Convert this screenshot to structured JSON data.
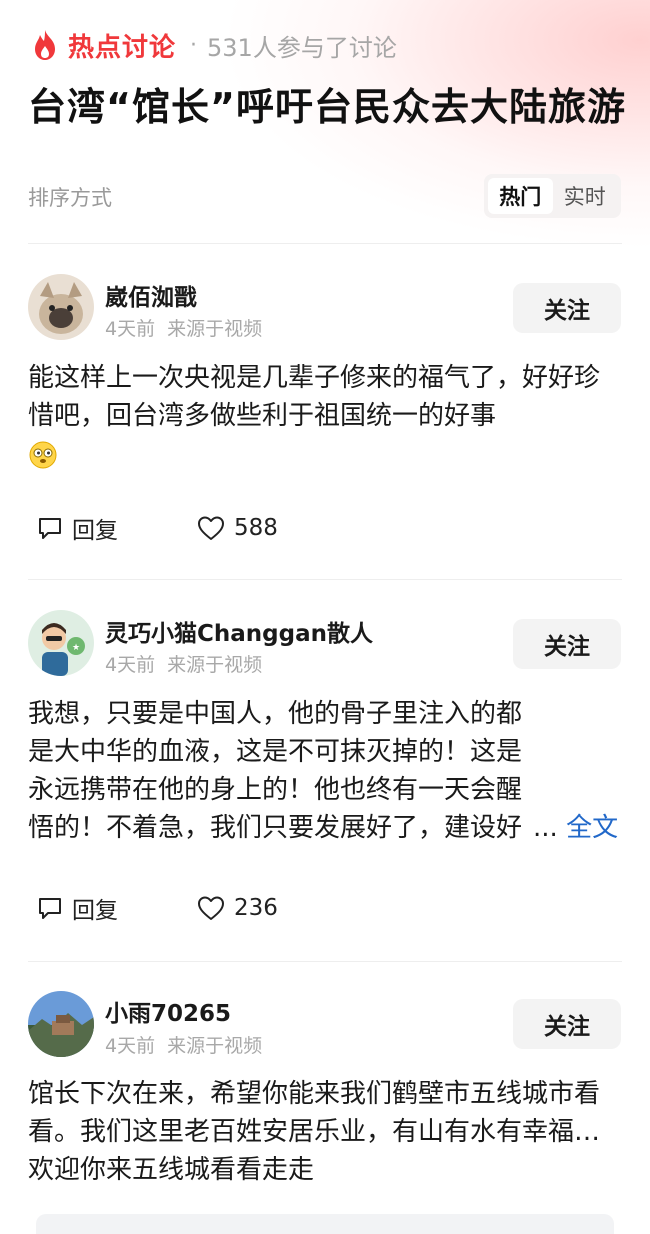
{
  "header": {
    "section_label": "热点讨论",
    "separator": "·",
    "participants": "531人参与了讨论",
    "topic_title": "台湾“馆长”呼吁台民众去大陆旅游",
    "flame_icon": "flame-icon",
    "accent_color": "#f0383b"
  },
  "sort": {
    "label": "排序方式",
    "options": [
      "热门",
      "实时"
    ],
    "selected": "热门"
  },
  "comments": [
    {
      "username": "崴佰洳戬",
      "time": "4天前",
      "source": "来源于视频",
      "follow_label": "关注",
      "text": "能这样上一次央视是几辈子修来的福气了，好好珍惜吧，回台湾多做些利于祖国统一的好事",
      "emoji": "dizzy-face-emoji",
      "reply_label": "回复",
      "likes": "588"
    },
    {
      "username": "灵巧小猫Changgan散人",
      "time": "4天前",
      "source": "来源于视频",
      "follow_label": "关注",
      "text": "我想，只要是中国人，他的骨子里注入的都是大中华的血液，这是不可抹灭掉的！这是永远携带在他的身上的！他也终有一天会醒悟的！不着急，我们只要发展好了，建设好",
      "more_ellipsis": "...",
      "more_label": "全文",
      "reply_label": "回复",
      "likes": "236"
    },
    {
      "username": "小雨70265",
      "time": "4天前",
      "source": "来源于视频",
      "follow_label": "关注",
      "text": "馆长下次在来，希望你能来我们鹤壁市五线城市看看。我们这里老百姓安居乐业，有山有水有幸福…欢迎你来五线城看看走走"
    }
  ]
}
